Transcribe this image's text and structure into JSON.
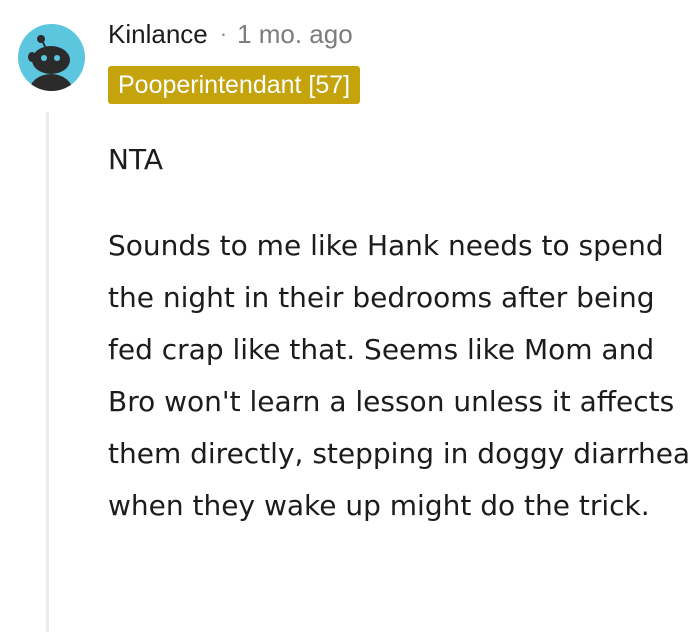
{
  "comment": {
    "username": "Kinlance",
    "separator": "·",
    "timestamp": "1 mo. ago",
    "flair": "Pooperintendant [57]",
    "avatar_icon": "snoo-avatar-icon",
    "paragraphs": [
      "NTA",
      "Sounds to me like Hank needs to spend the night in their bedrooms after being fed crap like that. Seems like Mom and Bro won't learn a lesson unless it affects them directly, stepping in doggy diarrhea when they wake up might do the trick."
    ]
  },
  "colors": {
    "avatar_bg": "#5cc6df",
    "flair_bg": "#c4a30d",
    "text": "#1c1c1c",
    "meta": "#7c7c7c",
    "thread_line": "#ececec"
  }
}
